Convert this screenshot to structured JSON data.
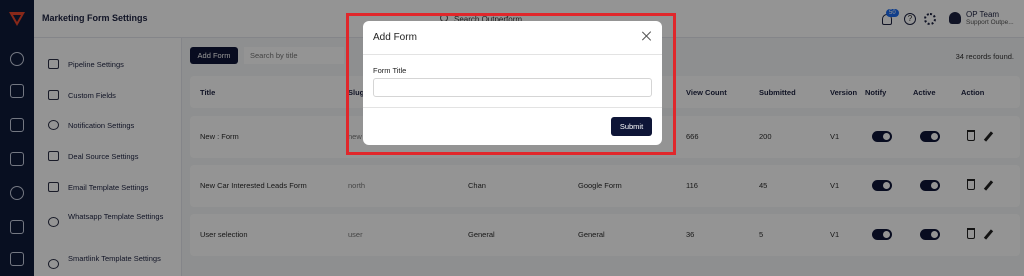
{
  "header": {
    "page_title": "Marketing Form Settings",
    "search_value": "Search Outperform",
    "notification_count": "50",
    "user_name": "OP Team",
    "user_role": "Support Outpe..."
  },
  "rail_icons": [
    "logo-icon",
    "dollar-icon",
    "contacts-icon",
    "calendar-icon",
    "clipboard-icon",
    "chart-icon",
    "document-icon",
    "chat-icon"
  ],
  "sidebar": {
    "items": [
      {
        "label": "Pipeline Settings",
        "icon": "pipeline-icon"
      },
      {
        "label": "Custom Fields",
        "icon": "edit-box-icon"
      },
      {
        "label": "Notification Settings",
        "icon": "bell-icon"
      },
      {
        "label": "Deal Source Settings",
        "icon": "megaphone-icon"
      },
      {
        "label": "Email Template Settings",
        "icon": "mail-icon"
      },
      {
        "label": "Whatsapp Template Settings",
        "icon": "whatsapp-icon"
      },
      {
        "label": "Smartlink Template Settings",
        "icon": "link-icon"
      }
    ]
  },
  "toolbar": {
    "add_form_label": "Add Form",
    "search_placeholder": "Search by title",
    "records_text": "34 records found."
  },
  "table": {
    "columns": [
      "Title",
      "Slug",
      "",
      "",
      "View Count",
      "Submitted",
      "Version",
      "Notify",
      "Active",
      "Action"
    ],
    "rows": [
      {
        "title": "New : Form",
        "slug": "new",
        "col3": "",
        "col4": "",
        "view_count": "666",
        "submitted": "200",
        "version": "V1"
      },
      {
        "title": "New Car Interested Leads Form",
        "slug": "north",
        "col3": "Chan",
        "col4": "Google Form",
        "view_count": "116",
        "submitted": "45",
        "version": "V1"
      },
      {
        "title": "User selection",
        "slug": "user",
        "col3": "General",
        "col4": "General",
        "view_count": "36",
        "submitted": "5",
        "version": "V1"
      }
    ]
  },
  "modal": {
    "title": "Add Form",
    "field_label": "Form Title",
    "field_value": "",
    "submit_label": "Submit"
  },
  "colors": {
    "primary_dark": "#0e1537",
    "rail_bg": "#0f1a3a",
    "highlight_frame": "#e0272b",
    "badge": "#1d6cf0"
  }
}
